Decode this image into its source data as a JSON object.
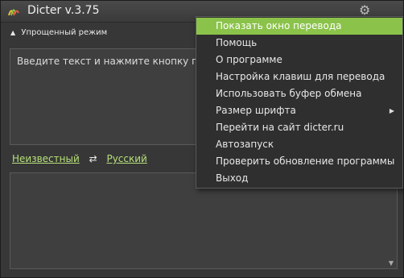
{
  "window": {
    "title": "Dicter v.3.75",
    "simple_mode_label": "Упрощенный режим",
    "input_placeholder": "Введите текст и нажмите кнопку перев",
    "source_lang": "Неизвестный",
    "target_lang": "Русский",
    "swap_symbol": "⇄"
  },
  "menu": {
    "items": [
      {
        "label": "Показать окно перевода"
      },
      {
        "label": "Помощь"
      },
      {
        "label": "О программе"
      },
      {
        "label": "Настройка клавиш для перевода"
      },
      {
        "label": "Использовать буфер обмена"
      },
      {
        "label": "Размер шрифта"
      },
      {
        "label": "Перейти на сайт dicter.ru"
      },
      {
        "label": "Автозапуск"
      },
      {
        "label": "Проверить обновление программы"
      },
      {
        "label": "Выход"
      }
    ]
  },
  "colors": {
    "accent": "#8bc34a",
    "link": "#b7e07a"
  }
}
